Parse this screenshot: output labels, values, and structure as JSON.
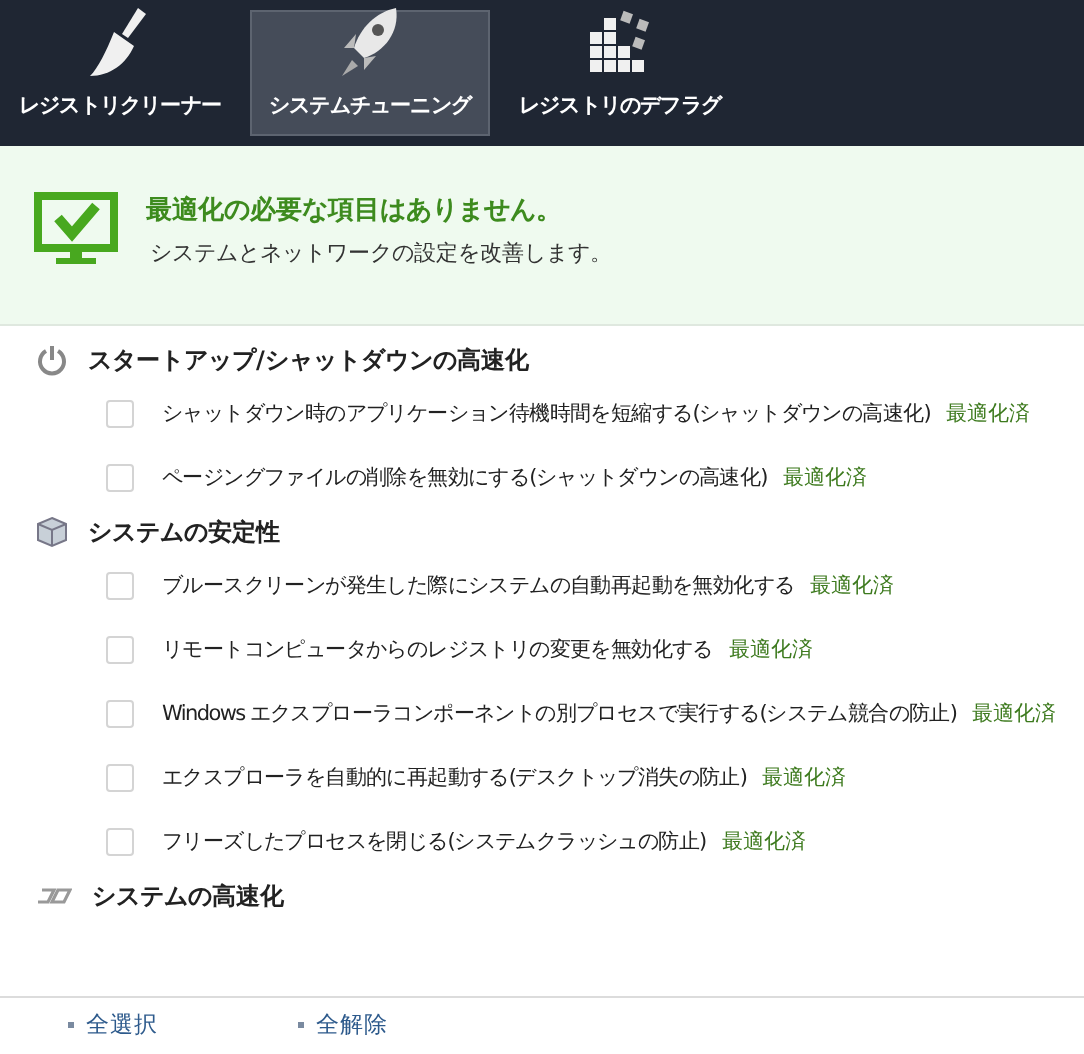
{
  "tabs": [
    {
      "label": "レジストリクリーナー",
      "selected": false
    },
    {
      "label": "システムチューニング",
      "selected": true
    },
    {
      "label": "レジストリのデフラグ",
      "selected": false
    }
  ],
  "banner": {
    "title": "最適化の必要な項目はありません。",
    "subtitle": "システムとネットワークの設定を改善します。"
  },
  "groups": [
    {
      "title": "スタートアップ/シャットダウンの高速化",
      "items": [
        {
          "label": "シャットダウン時のアプリケーション待機時間を短縮する(シャットダウンの高速化)",
          "checked": false,
          "status": "最適化済"
        },
        {
          "label": "ページングファイルの削除を無効にする(シャットダウンの高速化)",
          "checked": false,
          "status": "最適化済"
        }
      ]
    },
    {
      "title": "システムの安定性",
      "items": [
        {
          "label": "ブルースクリーンが発生した際にシステムの自動再起動を無効化する",
          "checked": false,
          "status": "最適化済"
        },
        {
          "label": "リモートコンピュータからのレジストリの変更を無効化する",
          "checked": false,
          "status": "最適化済"
        },
        {
          "label": "Windows エクスプローラコンポーネントの別プロセスで実行する(システム競合の防止)",
          "checked": false,
          "status": "最適化済"
        },
        {
          "label": "エクスプローラを自動的に再起動する(デスクトップ消失の防止)",
          "checked": false,
          "status": "最適化済"
        },
        {
          "label": "フリーズしたプロセスを閉じる(システムクラッシュの防止)",
          "checked": false,
          "status": "最適化済"
        }
      ]
    },
    {
      "title": "システムの高速化"
    }
  ],
  "footer_links": [
    "全選択",
    "全解除"
  ]
}
